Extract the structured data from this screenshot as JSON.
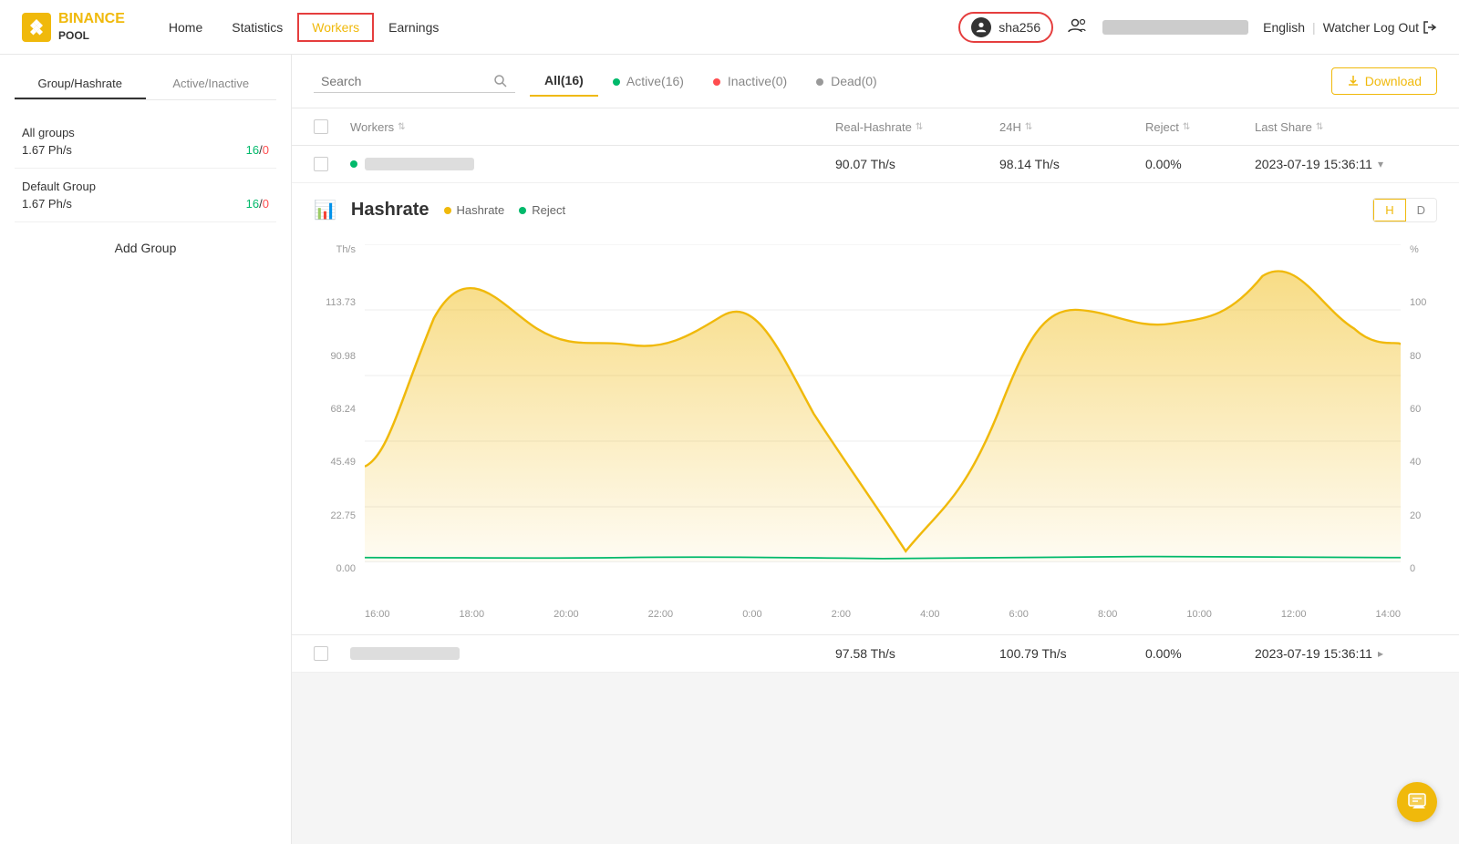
{
  "header": {
    "logo_line1": "BINANCE",
    "logo_line2": "POOL",
    "nav": [
      {
        "label": "Home",
        "active": false
      },
      {
        "label": "Statistics",
        "active": false
      },
      {
        "label": "Workers",
        "active": true
      },
      {
        "label": "Earnings",
        "active": false
      }
    ],
    "account": "sha256",
    "language": "English",
    "logout_label": "Watcher Log Out"
  },
  "sidebar": {
    "tab1": "Group/Hashrate",
    "tab2": "Active/Inactive",
    "groups": [
      {
        "name": "All groups",
        "hashrate": "1.67 Ph/s",
        "active": "16",
        "inactive": "0"
      },
      {
        "name": "Default Group",
        "hashrate": "1.67 Ph/s",
        "active": "16",
        "inactive": "0"
      }
    ],
    "add_group_label": "Add Group"
  },
  "filter_bar": {
    "search_placeholder": "Search",
    "tabs": [
      {
        "label": "All(16)",
        "active": true,
        "dot": null
      },
      {
        "label": "Active(16)",
        "active": false,
        "dot": "green"
      },
      {
        "label": "Inactive(0)",
        "active": false,
        "dot": "red"
      },
      {
        "label": "Dead(0)",
        "active": false,
        "dot": "gray"
      }
    ],
    "download_label": "Download"
  },
  "table": {
    "columns": [
      "Workers",
      "Real-Hashrate",
      "24H",
      "Reject",
      "Last Share"
    ],
    "row1": {
      "worker_name": "",
      "real_hashrate": "90.07 Th/s",
      "h24": "98.14 Th/s",
      "reject": "0.00%",
      "last_share": "2023-07-19 15:36:11"
    },
    "row2": {
      "worker_name": "",
      "real_hashrate": "97.58 Th/s",
      "h24": "100.79 Th/s",
      "reject": "0.00%",
      "last_share": "2023-07-19 15:36:11"
    }
  },
  "chart": {
    "title": "Hashrate",
    "legend_hashrate": "Hashrate",
    "legend_reject": "Reject",
    "time_btn_h": "H",
    "time_btn_d": "D",
    "y_labels_left": [
      "113.73",
      "90.98",
      "68.24",
      "45.49",
      "22.75",
      "0.00"
    ],
    "y_labels_right": [
      "100",
      "80",
      "60",
      "40",
      "20",
      "0"
    ],
    "x_labels": [
      "16:00",
      "18:00",
      "20:00",
      "22:00",
      "0:00",
      "2:00",
      "4:00",
      "6:00",
      "8:00",
      "10:00",
      "12:00",
      "14:00"
    ],
    "y_unit_left": "Th/s",
    "y_unit_right": "%"
  }
}
